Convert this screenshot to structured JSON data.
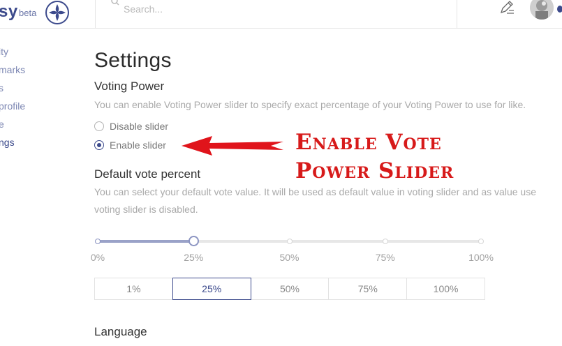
{
  "brand": {
    "name": "sy",
    "badge": "beta"
  },
  "search": {
    "placeholder": "Search..."
  },
  "sidebar": {
    "items": [
      {
        "label": "ity",
        "active": false
      },
      {
        "label": "marks",
        "active": false
      },
      {
        "label": "s",
        "active": false
      },
      {
        "label": "profile",
        "active": false
      },
      {
        "label": "e",
        "active": false
      },
      {
        "label": "ngs",
        "active": true
      }
    ]
  },
  "settings": {
    "title": "Settings",
    "voting_power": {
      "title": "Voting Power",
      "description": "You can enable Voting Power slider to specify exact percentage of your Voting Power to use for like.",
      "options": [
        {
          "label": "Disable slider",
          "checked": false
        },
        {
          "label": "Enable slider",
          "checked": true
        }
      ]
    },
    "default_vote": {
      "title": "Default vote percent",
      "description_line1": "You can select your default vote value. It will be used as default value in voting slider and as value use",
      "description_line2": "voting slider is disabled.",
      "slider_value_percent": 25,
      "slider_ticks": [
        "0%",
        "25%",
        "50%",
        "75%",
        "100%"
      ],
      "presets": [
        "1%",
        "25%",
        "50%",
        "75%",
        "100%"
      ],
      "selected_preset": "25%"
    },
    "language": {
      "title": "Language"
    }
  },
  "annotation": {
    "line1": "Enable Vote",
    "line2": "Power Slider",
    "color": "#d71a1a"
  },
  "colors": {
    "accent": "#3c4a8c",
    "muted_text": "#a9a9a9",
    "annotation_red": "#d71a1a"
  }
}
